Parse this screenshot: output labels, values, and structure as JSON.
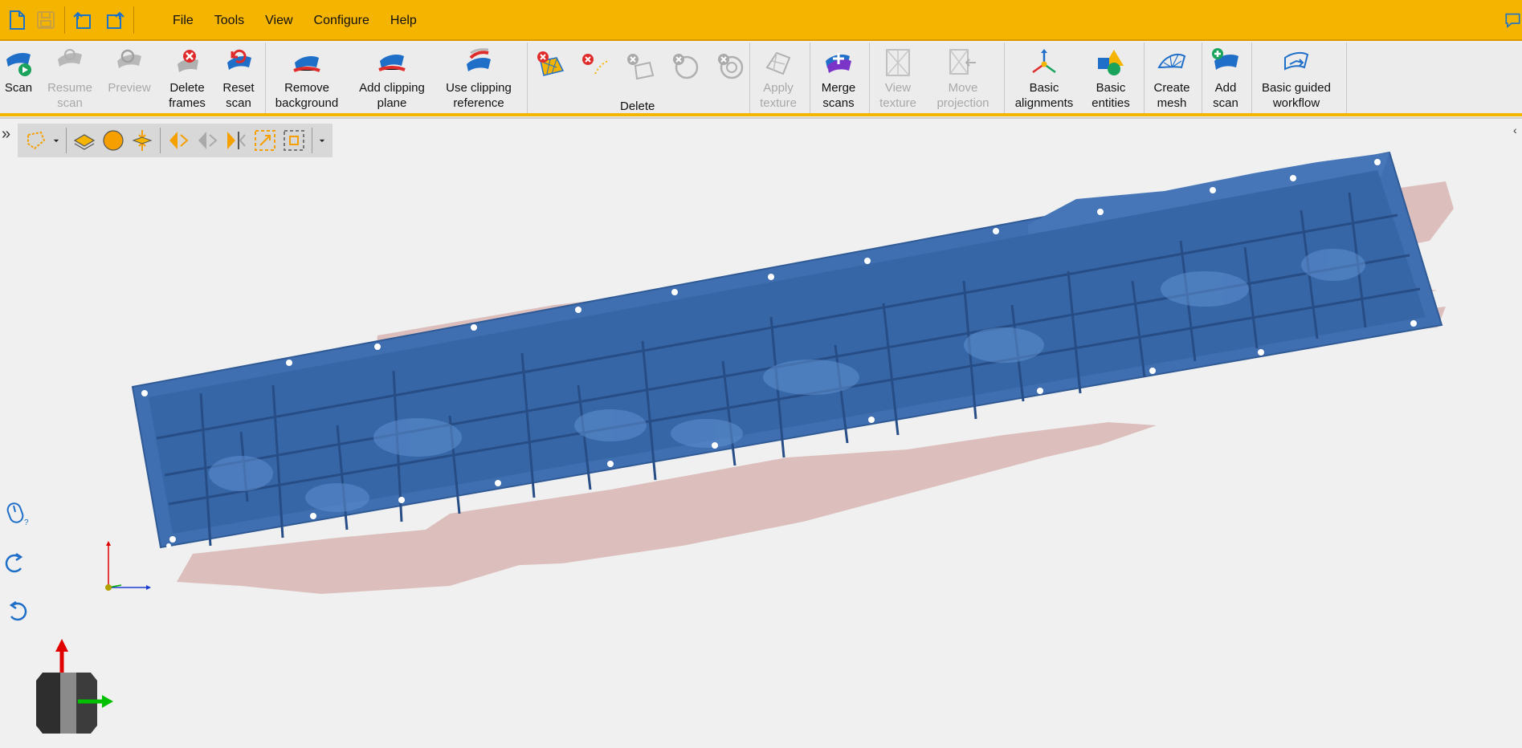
{
  "menubar": {
    "items": [
      "File",
      "Tools",
      "View",
      "Configure",
      "Help"
    ]
  },
  "quick_access": [
    "new-file-icon",
    "save-icon",
    "undo-icon",
    "redo-icon"
  ],
  "ribbon": {
    "scan": "Scan",
    "resume_scan": "Resume\nscan",
    "preview": "Preview",
    "delete_frames": "Delete\nframes",
    "reset_scan": "Reset\nscan",
    "remove_background": "Remove\nbackground",
    "add_clipping_plane": "Add clipping\nplane",
    "use_clipping_reference": "Use clipping\nreference",
    "delete_group": "Delete",
    "apply_texture": "Apply\ntexture",
    "merge_scans": "Merge\nscans",
    "view_texture": "View\ntexture",
    "move_projection": "Move\nprojection",
    "basic_alignments": "Basic\nalignments",
    "basic_entities": "Basic\nentities",
    "create_mesh": "Create\nmesh",
    "add_scan": "Add\nscan",
    "basic_guided_workflow": "Basic guided\nworkflow"
  },
  "colors": {
    "accent": "#f5b400",
    "scan_blue": "#3f6fb0",
    "background_cloud": "#d9b8b6",
    "ribbon_bg": "#ececec",
    "disabled_text": "#a8a8a8"
  },
  "viewport_tools": [
    "lasso-select-icon",
    "dropdown-icon",
    "layers-icon",
    "sphere-icon",
    "center-icon",
    "flip-icon",
    "prev-icon",
    "next-icon",
    "fit-view-icon",
    "fit-selection-icon",
    "more-icon"
  ]
}
